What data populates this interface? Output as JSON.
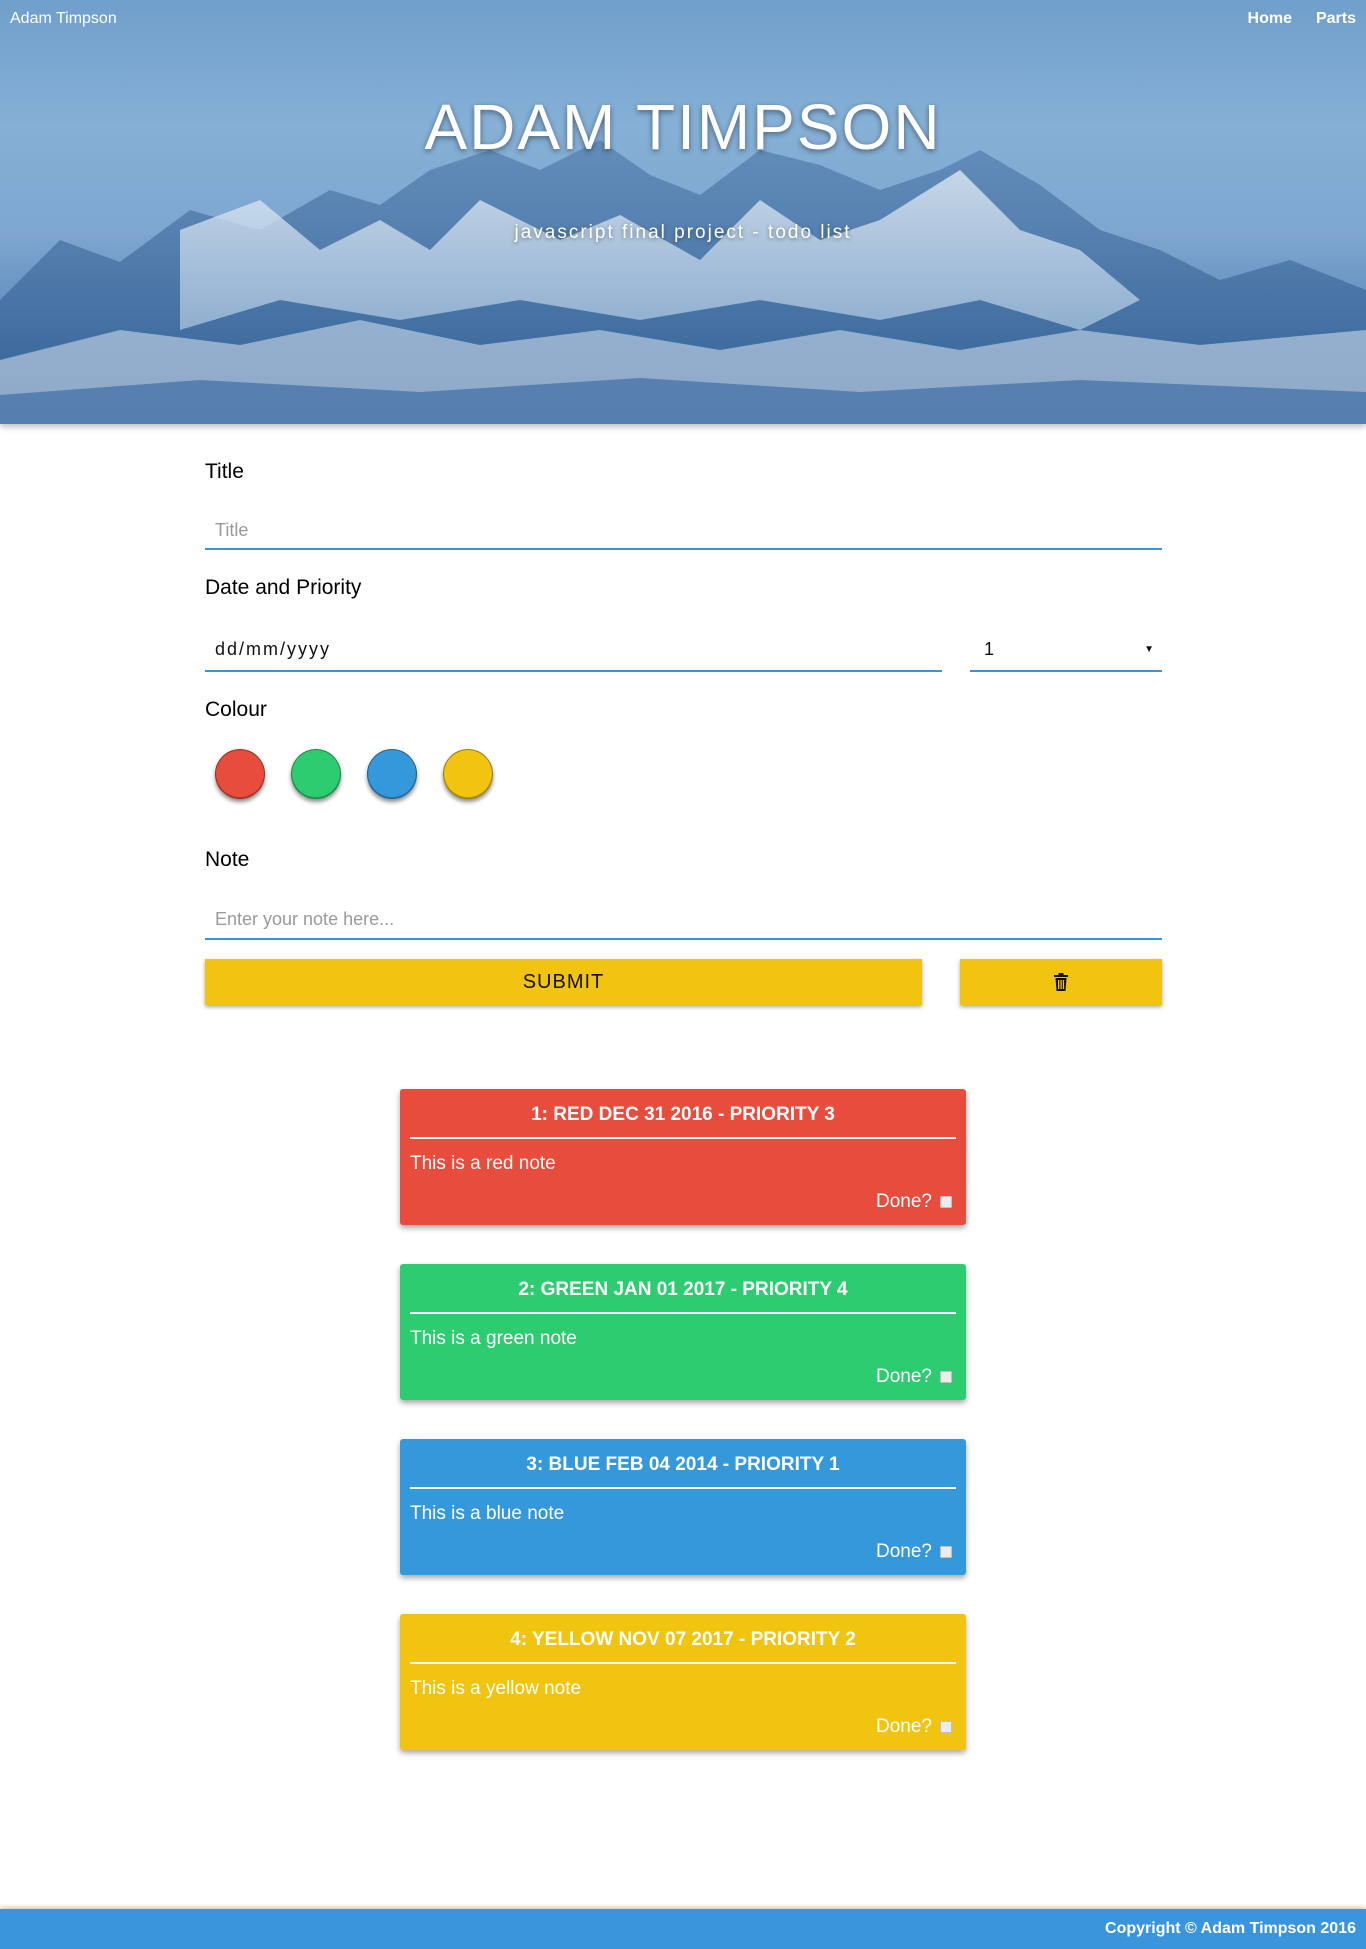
{
  "header": {
    "brand": "Adam Timpson",
    "nav": [
      "Home",
      "Parts"
    ],
    "title": "ADAM TIMPSON",
    "subtitle": "javascript final project - todo list"
  },
  "form": {
    "title_label": "Title",
    "title_placeholder": "Title",
    "date_priority_label": "Date and Priority",
    "date_value": "dd/mm/yyyy",
    "priority_value": "1",
    "colour_label": "Colour",
    "colours": [
      {
        "name": "red",
        "hex": "#e74c3c"
      },
      {
        "name": "green",
        "hex": "#2ecc71"
      },
      {
        "name": "blue",
        "hex": "#3498db"
      },
      {
        "name": "yellow",
        "hex": "#f1c40f"
      }
    ],
    "note_label": "Note",
    "note_placeholder": "Enter your note here...",
    "submit_label": "SUBMIT",
    "delete_icon": "trash-icon"
  },
  "notes": [
    {
      "heading": "1: RED DEC 31 2016 - PRIORITY 3",
      "body": "This is a red note",
      "done_label": "Done?",
      "color": "#e74c3c"
    },
    {
      "heading": "2: GREEN JAN 01 2017 - PRIORITY 4",
      "body": "This is a green note",
      "done_label": "Done?",
      "color": "#2ecc71"
    },
    {
      "heading": "3: BLUE FEB 04 2014 - PRIORITY 1",
      "body": "This is a blue note",
      "done_label": "Done?",
      "color": "#3498db"
    },
    {
      "heading": "4: YELLOW NOV 07 2017 - PRIORITY 2",
      "body": "This is a yellow note",
      "done_label": "Done?",
      "color": "#f1c40f"
    }
  ],
  "footer": {
    "copyright": "Copyright © Adam Timpson 2016"
  },
  "colors": {
    "accent": "#3a95dd",
    "button": "#f1c40f"
  }
}
